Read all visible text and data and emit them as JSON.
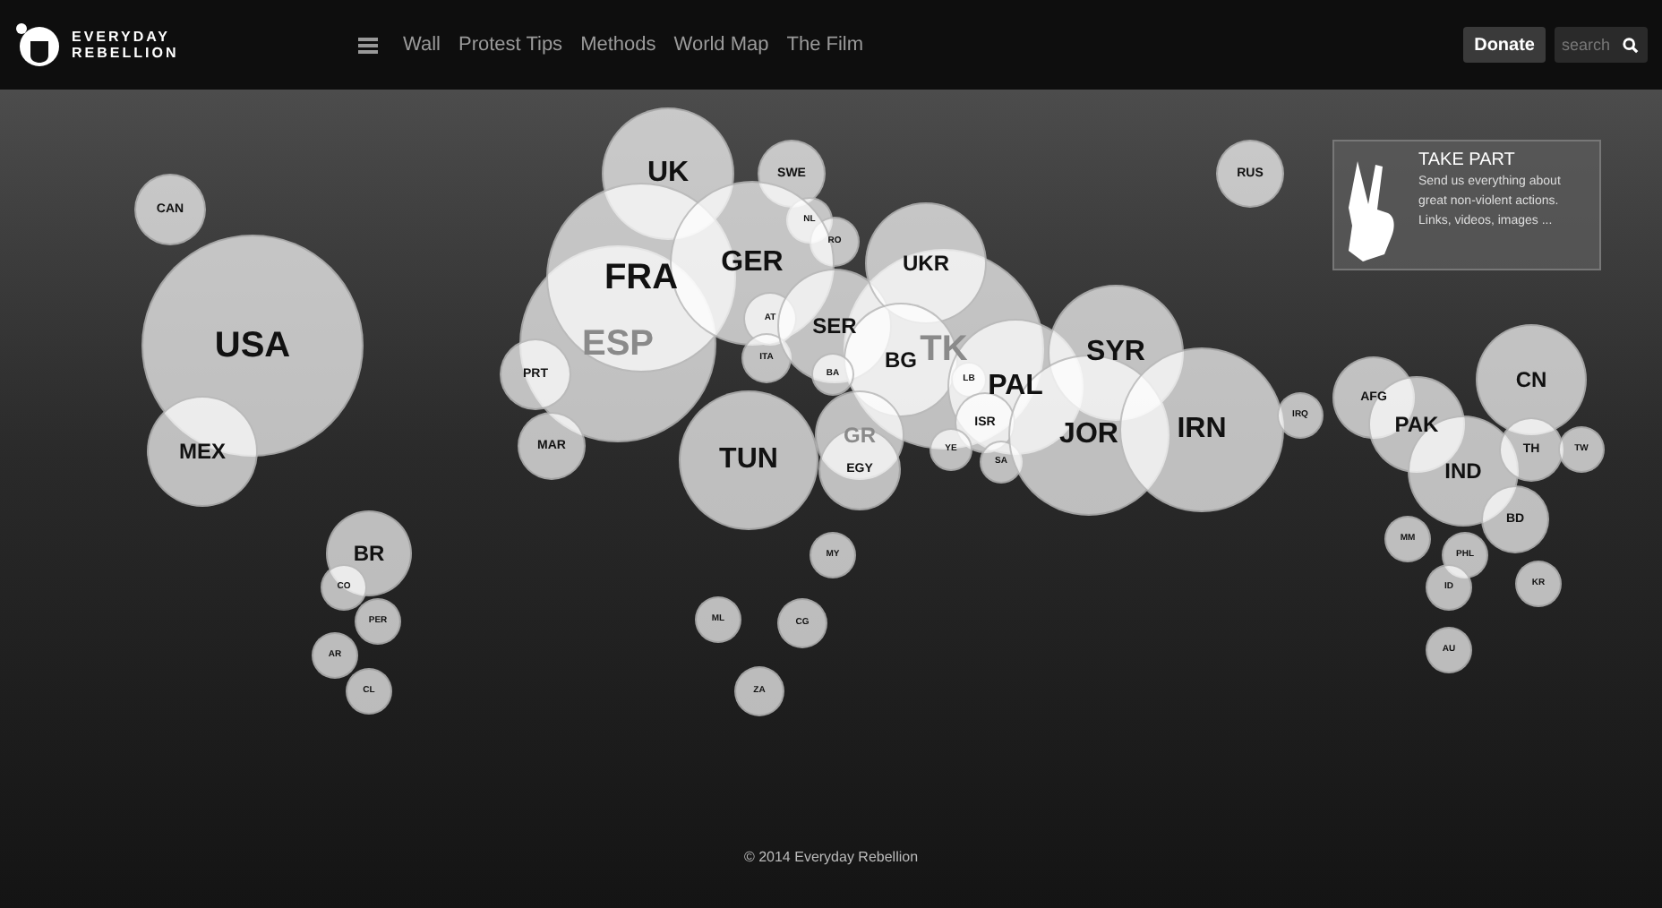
{
  "header": {
    "logo_lines": [
      "EVERYDAY",
      "REBELLION"
    ],
    "nav": [
      "Wall",
      "Protest Tips",
      "Methods",
      "World Map",
      "The Film"
    ],
    "donate": "Donate",
    "search": {
      "placeholder": "search"
    }
  },
  "map": {
    "bubbles": [
      {
        "label": "CAN",
        "faded": false
      },
      {
        "label": "USA",
        "faded": false
      },
      {
        "label": "MEX",
        "faded": false
      },
      {
        "label": "UK",
        "faded": false
      },
      {
        "label": "SWE",
        "faded": false
      },
      {
        "label": "NL",
        "faded": false
      },
      {
        "label": "RO",
        "faded": false
      },
      {
        "label": "ESP",
        "faded": true
      },
      {
        "label": "FRA",
        "faded": false
      },
      {
        "label": "GER",
        "faded": false
      },
      {
        "label": "PRT",
        "faded": false
      },
      {
        "label": "MAR",
        "faded": false
      },
      {
        "label": "AT",
        "faded": false
      },
      {
        "label": "ITA",
        "faded": false
      },
      {
        "label": "TK",
        "faded": true
      },
      {
        "label": "SER",
        "faded": false
      },
      {
        "label": "UKR",
        "faded": false
      },
      {
        "label": "BG",
        "faded": false
      },
      {
        "label": "BA",
        "faded": false
      },
      {
        "label": "GR",
        "faded": true
      },
      {
        "label": "EGY",
        "faded": false
      },
      {
        "label": "TUN",
        "faded": false
      },
      {
        "label": "LB",
        "faded": false
      },
      {
        "label": "PAL",
        "faded": false
      },
      {
        "label": "ISR",
        "faded": false
      },
      {
        "label": "YE",
        "faded": false
      },
      {
        "label": "SA",
        "faded": false
      },
      {
        "label": "SYR",
        "faded": false
      },
      {
        "label": "JOR",
        "faded": false
      },
      {
        "label": "IRN",
        "faded": false
      },
      {
        "label": "IRQ",
        "faded": false
      },
      {
        "label": "RUS",
        "faded": false
      },
      {
        "label": "AFG",
        "faded": false
      },
      {
        "label": "PAK",
        "faded": false
      },
      {
        "label": "CN",
        "faded": false
      },
      {
        "label": "IND",
        "faded": false
      },
      {
        "label": "TH",
        "faded": false
      },
      {
        "label": "TW",
        "faded": false
      },
      {
        "label": "BD",
        "faded": false
      },
      {
        "label": "MM",
        "faded": false
      },
      {
        "label": "PHL",
        "faded": false
      },
      {
        "label": "ID",
        "faded": false
      },
      {
        "label": "KR",
        "faded": false
      },
      {
        "label": "AU",
        "faded": false
      },
      {
        "label": "MY",
        "faded": false
      },
      {
        "label": "ML",
        "faded": false
      },
      {
        "label": "CG",
        "faded": false
      },
      {
        "label": "ZA",
        "faded": false
      },
      {
        "label": "BR",
        "faded": false
      },
      {
        "label": "CO",
        "faded": false
      },
      {
        "label": "PER",
        "faded": false
      },
      {
        "label": "AR",
        "faded": false
      },
      {
        "label": "CL",
        "faded": false
      }
    ]
  },
  "take_part": {
    "title": "TAKE PART",
    "text": "Send us everything about great non-violent actions. Links, videos, images ..."
  },
  "footer": "© 2014 Everyday Rebellion"
}
